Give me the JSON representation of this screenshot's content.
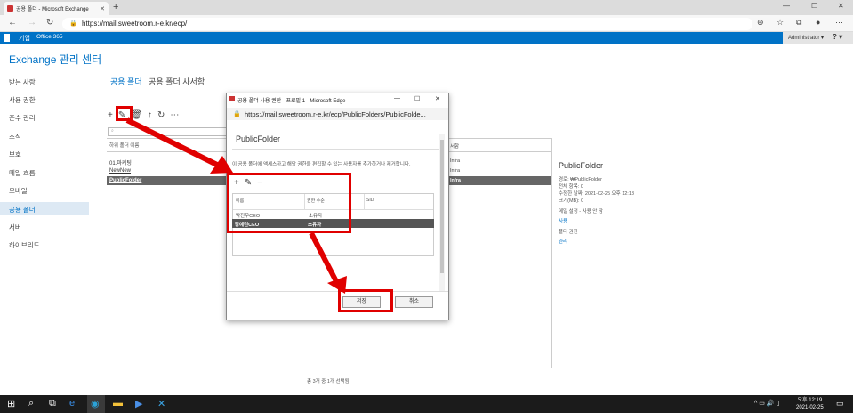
{
  "browser": {
    "tab_title": "공용 폴더 - Microsoft Exchange",
    "url": "https://mail.sweetroom.r-e.kr/ecp/"
  },
  "o365": {
    "company": "기업",
    "product": "Office 365",
    "user": "Administrator ▾",
    "help": "? ▾"
  },
  "eac": {
    "title": "Exchange 관리 센터",
    "nav": [
      "받는 사람",
      "사용 권한",
      "준수 관리",
      "조직",
      "보호",
      "메일 흐름",
      "모바일",
      "공용 폴더",
      "서버",
      "하이브리드"
    ],
    "subtabs": [
      "공용 폴더",
      "공용 폴더 사서함"
    ],
    "search_placeholder": "⌕",
    "col_header": "하위 폴더 이름",
    "col_header2": "서함",
    "rows": [
      {
        "name": "01.마케팅",
        "mailbox": "Infra"
      },
      {
        "name": "NewNew",
        "mailbox": "Infra"
      },
      {
        "name": "PublicFolder",
        "mailbox": "Infra"
      }
    ],
    "status": "총 3개 중 1개 선택됨"
  },
  "details": {
    "title": "PublicFolder",
    "lines": [
      "경로: ₩PublicFolder",
      "전체 항목: 0",
      "수정한 날짜: 2021-02-25 오후 12:18",
      "크기(MB): 0",
      "메일 설정 - 사용 안 함"
    ],
    "link_enable": "사용",
    "perm_label": "폴더 권한",
    "link_manage": "관리"
  },
  "dialog": {
    "title": "공용 폴더 사용 권한 - 프로필 1 - Microsoft Edge",
    "url": "https://mail.sweetroom.r-e.kr/ecp/PublicFolders/PublicFolde...",
    "heading": "PublicFolder",
    "desc": "이 공용 폴더에 액세스하고 해당 권한을 편집할 수 있는 사용자를 추가하거나 제거합니다.",
    "columns": [
      "이름",
      "권한 수준",
      "SID"
    ],
    "rows": [
      {
        "name": "박진우CEO",
        "level": "소유자"
      },
      {
        "name": "장예린CEO",
        "level": "소유자"
      }
    ],
    "save": "저장",
    "cancel": "취소"
  },
  "taskbar": {
    "time": "오후 12:19",
    "date": "2021-02-25"
  },
  "colors": {
    "accent": "#0072c6",
    "annotation": "#e00000"
  }
}
